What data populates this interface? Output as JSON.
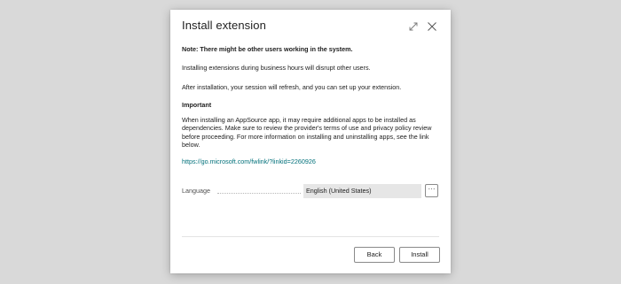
{
  "dialog": {
    "title": "Install extension",
    "note": "Note: There might be other users working in the system.",
    "paragraph1": "Installing extensions during business hours will disrupt other users.",
    "paragraph2": "After installation, your session will refresh, and you can set up your extension.",
    "important_heading": "Important",
    "paragraph3": "When installing an AppSource app, it may require additional apps to be installed as dependencies. Make sure to review the provider's terms of use and privacy policy review before proceeding. For more information on installing and uninstalling apps, see the link below.",
    "link_text": "https://go.microsoft.com/fwlink/?linkid=2260926",
    "language_label": "Language",
    "language_value": "English (United States)",
    "more_button": "···",
    "back_button": "Back",
    "install_button": "Install",
    "icons": {
      "expand": "expand-icon",
      "close": "close-icon"
    },
    "colors": {
      "link": "#00707a",
      "backdrop": "#d9d9d9"
    }
  }
}
